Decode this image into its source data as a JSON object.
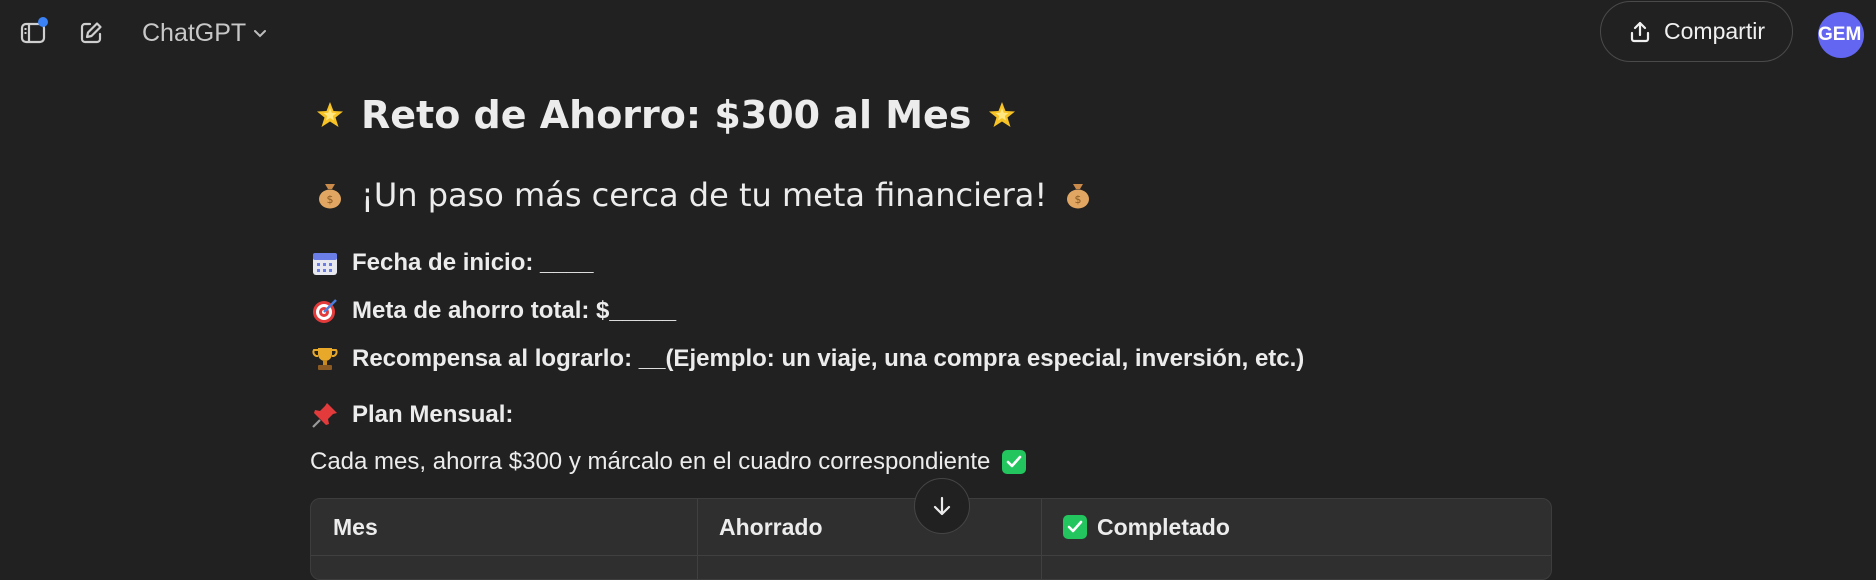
{
  "topbar": {
    "model_name": "ChatGPT",
    "share_label": "Compartir",
    "avatar_initials": "GEM"
  },
  "message": {
    "title": "Reto de Ahorro: $300 al Mes",
    "subtitle": "¡Un paso más cerca de tu meta financiera!",
    "start_date": "Fecha de inicio: ____",
    "total_goal": "Meta de ahorro total: $_____",
    "reward": "Recompensa al lograrlo: __(Ejemplo: un viaje, una compra especial, inversión, etc.)",
    "plan_label": "Plan Mensual:",
    "instruction": "Cada mes, ahorra $300 y márcalo en el cuadro correspondiente"
  },
  "table": {
    "headers": [
      "Mes",
      "Ahorrado",
      "Completado"
    ]
  },
  "icons": {
    "sparkle": "star-icon",
    "money_bag": "money-bag-icon",
    "calendar": "calendar-icon",
    "target": "target-icon",
    "trophy": "trophy-icon",
    "pin": "pushpin-icon",
    "check": "check-box-icon"
  },
  "colors": {
    "background": "#212121",
    "accent_blue": "#3b82f6",
    "avatar": "#6366f1",
    "check_green": "#22c55e"
  }
}
